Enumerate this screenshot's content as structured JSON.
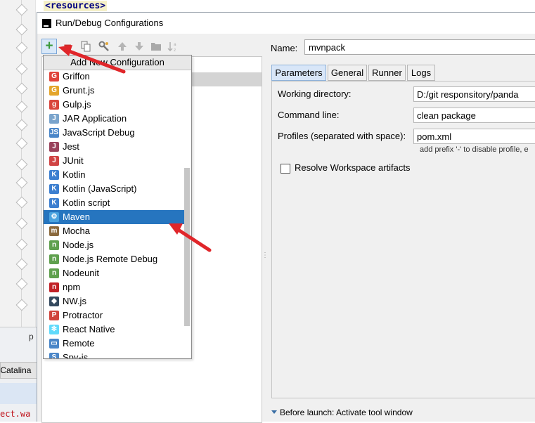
{
  "background": {
    "code_top": "<resources>",
    "catalina_tab": "Catalina",
    "bottom_code": "ect.wa",
    "panel_fragment": "p"
  },
  "dialog": {
    "title": "Run/Debug Configurations",
    "toolbar": {
      "add_tooltip": "Add New Configuration"
    },
    "config_types": [
      {
        "label": "Griffon",
        "icon": "griffon-icon",
        "color": "#e0443c"
      },
      {
        "label": "Grunt.js",
        "icon": "grunt-icon",
        "color": "#e4a52b"
      },
      {
        "label": "Gulp.js",
        "icon": "gulp-icon",
        "color": "#d9453c"
      },
      {
        "label": "JAR Application",
        "icon": "jar-icon",
        "color": "#7aa4cc"
      },
      {
        "label": "JavaScript Debug",
        "icon": "javascript-debug-icon",
        "color": "#4a86c8"
      },
      {
        "label": "Jest",
        "icon": "jest-icon",
        "color": "#99425b"
      },
      {
        "label": "JUnit",
        "icon": "junit-icon",
        "color": "#d04343"
      },
      {
        "label": "Kotlin",
        "icon": "kotlin-icon",
        "color": "#3c7fd0"
      },
      {
        "label": "Kotlin (JavaScript)",
        "icon": "kotlin-js-icon",
        "color": "#3c7fd0"
      },
      {
        "label": "Kotlin script",
        "icon": "kotlin-script-icon",
        "color": "#3c7fd0"
      },
      {
        "label": "Maven",
        "icon": "maven-icon",
        "color": "#4aa3df"
      },
      {
        "label": "Mocha",
        "icon": "mocha-icon",
        "color": "#8b6a3d"
      },
      {
        "label": "Node.js",
        "icon": "nodejs-icon",
        "color": "#5fa04e"
      },
      {
        "label": "Node.js Remote Debug",
        "icon": "nodejs-remote-debug-icon",
        "color": "#5fa04e"
      },
      {
        "label": "Nodeunit",
        "icon": "nodeunit-icon",
        "color": "#5fa04e"
      },
      {
        "label": "npm",
        "icon": "npm-icon",
        "color": "#c12127"
      },
      {
        "label": "NW.js",
        "icon": "nwjs-icon",
        "color": "#34495e"
      },
      {
        "label": "Protractor",
        "icon": "protractor-icon",
        "color": "#d0433b"
      },
      {
        "label": "React Native",
        "icon": "react-native-icon",
        "color": "#61dafb"
      },
      {
        "label": "Remote",
        "icon": "remote-icon",
        "color": "#4a86c8"
      },
      {
        "label": "Spy-js",
        "icon": "spyjs-icon",
        "color": "#4a86c8"
      }
    ],
    "selected_type": "Maven",
    "name_label": "Name:",
    "name_value": "mvnpack",
    "tabs": [
      "Parameters",
      "General",
      "Runner",
      "Logs"
    ],
    "active_tab": "Parameters",
    "form": {
      "working_dir_label": "Working directory:",
      "working_dir_value": "D:/git responsitory/panda",
      "command_line_label": "Command line:",
      "command_line_value": "clean package",
      "profiles_label": "Profiles (separated with space):",
      "profiles_value": "pom.xml",
      "profiles_hint": "add prefix '-' to disable profile, e",
      "resolve_workspace_label": "Resolve Workspace artifacts",
      "resolve_workspace_checked": false
    },
    "before_launch": "Before launch: Activate tool window"
  },
  "colors": {
    "selection": "#2675bf",
    "annotation_arrow": "#e0262a"
  }
}
